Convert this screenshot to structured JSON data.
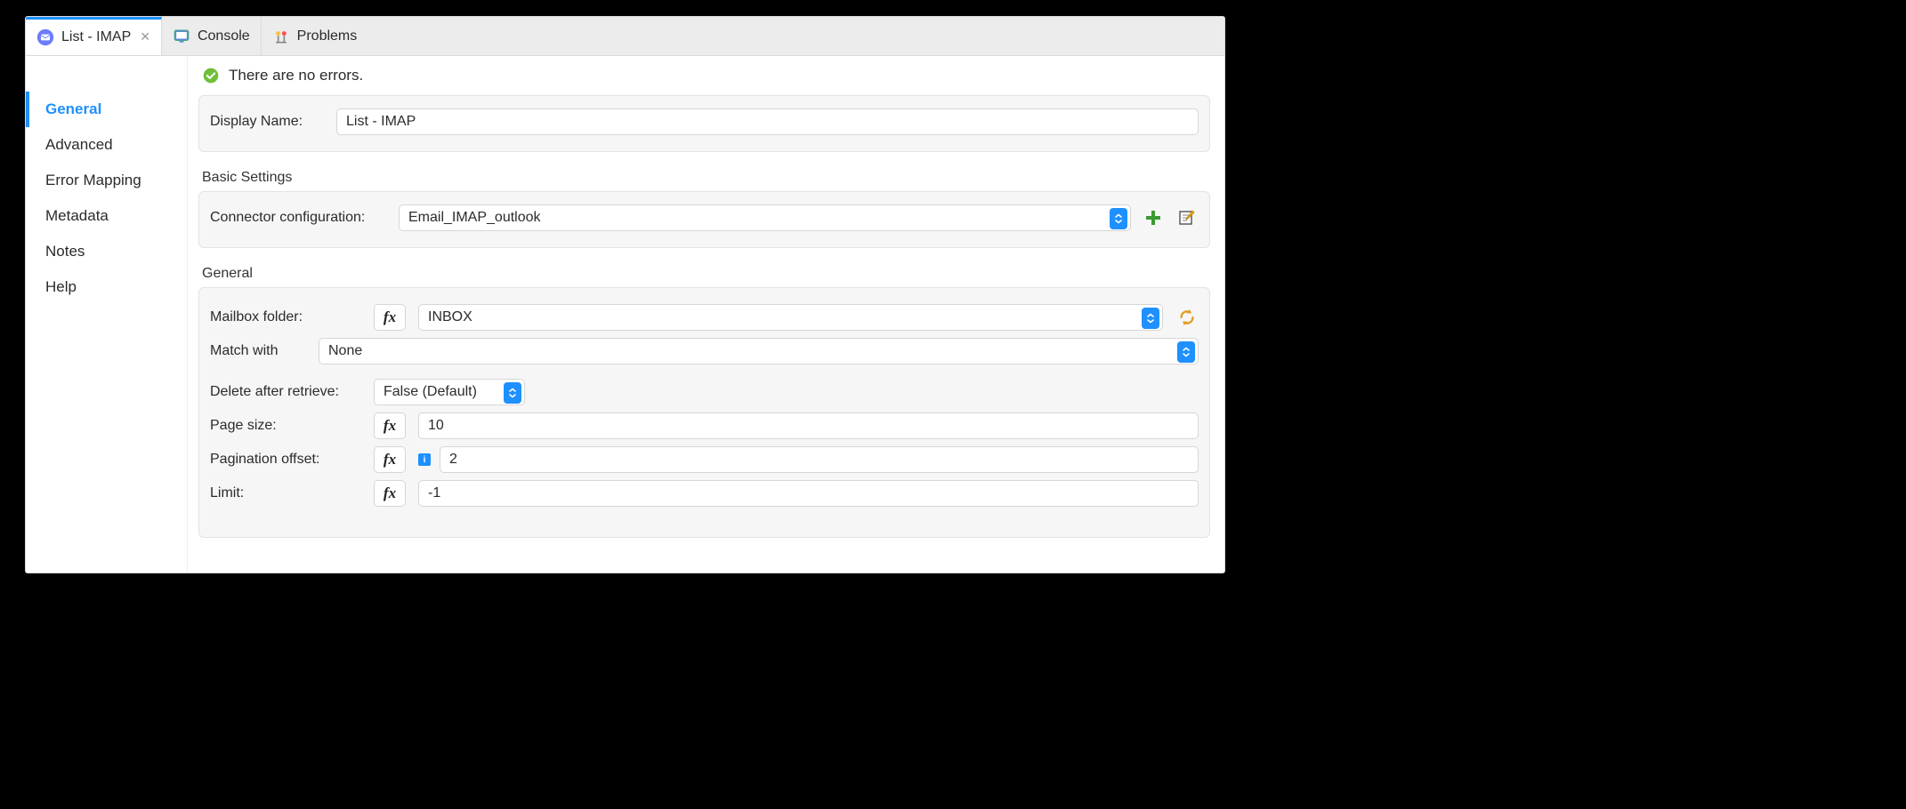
{
  "tabs": {
    "active": {
      "label": "List - IMAP"
    },
    "others": [
      {
        "label": "Console"
      },
      {
        "label": "Problems"
      }
    ]
  },
  "status": {
    "text": "There are no errors."
  },
  "sidebar": {
    "items": [
      {
        "label": "General",
        "active": true
      },
      {
        "label": "Advanced"
      },
      {
        "label": "Error Mapping"
      },
      {
        "label": "Metadata"
      },
      {
        "label": "Notes"
      },
      {
        "label": "Help"
      }
    ]
  },
  "displayName": {
    "label": "Display Name:",
    "value": "List - IMAP"
  },
  "basicSettings": {
    "title": "Basic Settings",
    "connectorConfig": {
      "label": "Connector configuration:",
      "value": "Email_IMAP_outlook"
    }
  },
  "general": {
    "title": "General",
    "mailboxFolder": {
      "label": "Mailbox folder:",
      "value": "INBOX"
    },
    "matchWith": {
      "label": "Match with",
      "value": "None"
    },
    "deleteAfterRetrieve": {
      "label": "Delete after retrieve:",
      "value": "False (Default)"
    },
    "pageSize": {
      "label": "Page size:",
      "value": "10"
    },
    "paginationOffset": {
      "label": "Pagination offset:",
      "value": "2"
    },
    "limit": {
      "label": "Limit:",
      "value": "-1"
    }
  }
}
